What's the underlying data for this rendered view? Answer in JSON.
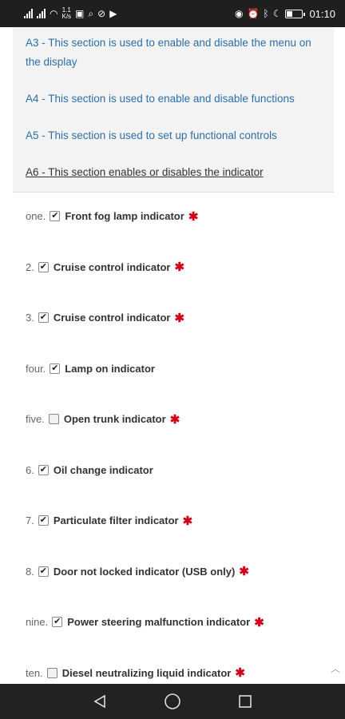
{
  "status_bar": {
    "speed": "1.1\nK/s",
    "time": "01:10",
    "battery_level": 0.4,
    "icons": [
      "signal-icon",
      "signal-icon",
      "wifi-icon",
      "speed-text",
      "p-app-icon",
      "search-app-icon",
      "settings-app-icon",
      "video-app-icon",
      "eye-icon",
      "alarm-icon",
      "bluetooth-icon",
      "moon-icon",
      "battery-icon"
    ]
  },
  "menu": {
    "items": [
      {
        "label": "A3 - This section is used to enable and disable the menu on the display",
        "active": false
      },
      {
        "label": "A4 - This section is used to enable and disable functions",
        "active": false
      },
      {
        "label": "A5 - This section is used to set up functional controls",
        "active": false
      },
      {
        "label": "A6 - This section enables or disables the indicator",
        "active": true
      }
    ]
  },
  "indicators": [
    {
      "num": "one.",
      "label": "Front fog lamp indicator",
      "checked": true,
      "required": true
    },
    {
      "num": "2.",
      "label": "Cruise control indicator",
      "checked": true,
      "required": true
    },
    {
      "num": "3.",
      "label": "Cruise control indicator",
      "checked": true,
      "required": true
    },
    {
      "num": "four.",
      "label": "Lamp on indicator",
      "checked": true,
      "required": false
    },
    {
      "num": "five.",
      "label": "Open trunk indicator",
      "checked": false,
      "required": true
    },
    {
      "num": "6.",
      "label": "Oil change indicator",
      "checked": true,
      "required": false
    },
    {
      "num": "7.",
      "label": "Particulate filter indicator",
      "checked": true,
      "required": true
    },
    {
      "num": "8.",
      "label": "Door not locked indicator (USB only)",
      "checked": true,
      "required": true
    },
    {
      "num": "nine.",
      "label": "Power steering malfunction indicator",
      "checked": true,
      "required": true
    },
    {
      "num": "ten.",
      "label": "Diesel neutralizing liquid indicator",
      "checked": false,
      "required": true
    }
  ],
  "required_mark": "✱",
  "colors": {
    "link": "#2c6fa8",
    "required": "#d0021b",
    "status_bar": "#1f1f1f",
    "nav_bar": "#222222"
  },
  "nav": [
    "back-icon",
    "home-icon",
    "recents-icon"
  ]
}
